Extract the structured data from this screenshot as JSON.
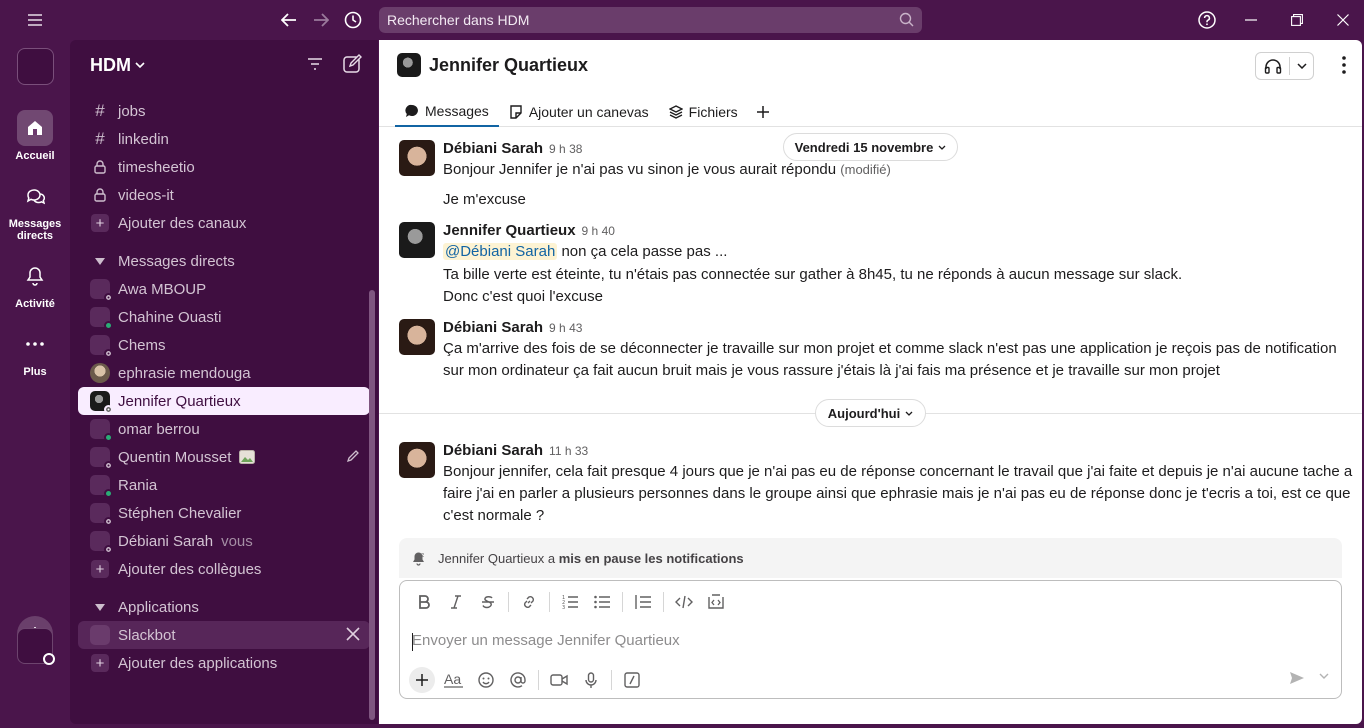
{
  "search": {
    "placeholder": "Rechercher dans HDM"
  },
  "rail": {
    "items": [
      {
        "label": "Accueil"
      },
      {
        "label": "Messages directs"
      },
      {
        "label": "Activité"
      },
      {
        "label": "Plus"
      }
    ]
  },
  "sidebar": {
    "workspace_name": "HDM",
    "channels": [
      {
        "label": "jobs",
        "icon": "hash-icon"
      },
      {
        "label": "linkedin",
        "icon": "hash-icon"
      },
      {
        "label": "timesheetio",
        "icon": "lock-icon"
      },
      {
        "label": "videos-it",
        "icon": "lock-icon"
      }
    ],
    "add_channels": "Ajouter des canaux",
    "dm_section": "Messages directs",
    "dms": [
      {
        "label": "Awa MBOUP",
        "status": "off"
      },
      {
        "label": "Chahine Ouasti",
        "status": "on"
      },
      {
        "label": "Chems",
        "status": "off"
      },
      {
        "label": "ephrasie mendouga",
        "status": "photo"
      },
      {
        "label": "Jennifer Quartieux",
        "status": "photo-active"
      },
      {
        "label": "omar berrou",
        "status": "on"
      },
      {
        "label": "Quentin Mousset",
        "status": "off"
      },
      {
        "label": "Rania",
        "status": "on"
      },
      {
        "label": "Stéphen Chevalier",
        "status": "off"
      },
      {
        "label": "Débiani Sarah",
        "status": "off",
        "suffix": "vous"
      }
    ],
    "add_colleagues": "Ajouter des collègues",
    "apps_section": "Applications",
    "apps": [
      {
        "label": "Slackbot"
      }
    ],
    "add_apps": "Ajouter des applications"
  },
  "channel": {
    "title": "Jennifer Quartieux",
    "tabs": [
      {
        "label": "Messages"
      },
      {
        "label": "Ajouter un canevas"
      },
      {
        "label": "Fichiers"
      }
    ]
  },
  "dates": {
    "first": "Vendredi 15 novembre",
    "today": "Aujourd'hui"
  },
  "messages": [
    {
      "author": "Débiani Sarah",
      "time": "9 h 38",
      "lines": [
        "Bonjour Jennifer je n'ai pas vu sinon je vous aurait répondu"
      ],
      "edited": "(modifié)",
      "extra": "Je m'excuse"
    },
    {
      "author": "Jennifer Quartieux",
      "time": "9 h 40",
      "mention": "@Débiani Sarah",
      "lines": [
        " non ça cela passe pas ...",
        "Ta bille verte est éteinte, tu n'étais pas connectée sur gather à 8h45, tu ne réponds à aucun message sur slack.",
        "Donc c'est quoi l'excuse"
      ]
    },
    {
      "author": "Débiani Sarah",
      "time": "9 h 43",
      "lines": [
        "Ça m'arrive des fois de se déconnecter je travaille sur mon projet et comme slack n'est pas une application je reçois pas de notification",
        "sur mon ordinateur ça fait aucun bruit mais je vous rassure j'étais là j'ai fais ma présence et je travaille sur mon projet"
      ]
    },
    {
      "author": "Débiani Sarah",
      "time": "11 h 33",
      "lines": [
        "Bonjour jennifer, cela fait presque 4 jours que je n'ai pas eu de réponse concernant le travail que j'ai faite et depuis je n'ai aucune tache a",
        "faire j'ai en parler a plusieurs personnes dans le groupe ainsi que ephrasie mais je n'ai pas eu de réponse donc je t'ecris a toi, est ce que",
        "c'est normale ?"
      ]
    }
  ],
  "notice": {
    "prefix": "Jennifer Quartieux a ",
    "bold": "mis en pause les notifications"
  },
  "composer": {
    "placeholder": "Envoyer un message Jennifer Quartieux"
  },
  "colors": {
    "aubergine": "#4a154b",
    "sidebar": "#3f0e40",
    "active_row": "#f9edff",
    "online": "#2bac76",
    "link": "#1264a3"
  }
}
